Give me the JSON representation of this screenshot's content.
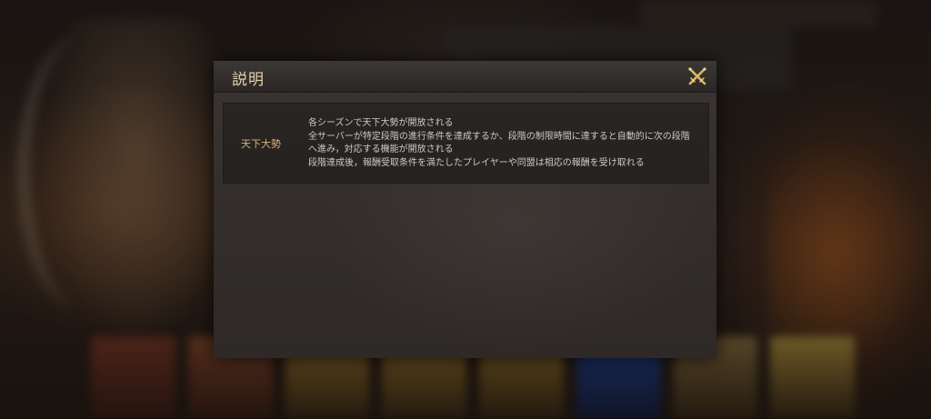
{
  "dialog": {
    "title": "説明",
    "close_icon": "crossed-swords-close-icon",
    "rows": [
      {
        "label": "天下大勢",
        "lines": [
          "各シーズンで天下大勢が開放される",
          "全サーバーが特定段階の進行条件を達成するか、段階の制限時間に達すると自動的に次の段階",
          "へ進み，対応する機能が開放される",
          "段階達成後，報酬受取条件を満たしたプレイヤーや同盟は相応の報酬を受け取れる"
        ]
      }
    ]
  },
  "colors": {
    "title": "#e6d4ae",
    "label": "#d6b27a",
    "text": "#cfc9c2",
    "close_icon": "#d9b56a",
    "panel": "#34302d"
  }
}
